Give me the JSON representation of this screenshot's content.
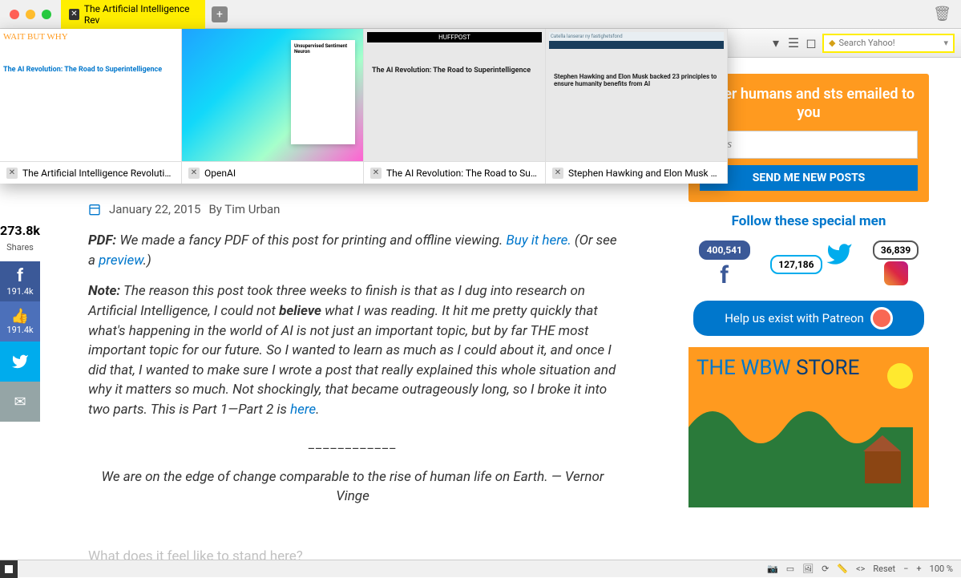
{
  "window": {
    "tab_title": "The Artificial Intelligence Rev"
  },
  "toolbar": {
    "search_placeholder": "Search Yahoo!"
  },
  "tab_switcher": {
    "thumbs": [
      {
        "label": "The Artificial Intelligence Revolution:",
        "headline": "The AI Revolution: The Road to Superintelligence",
        "logo": "WAIT BUT WHY"
      },
      {
        "label": "OpenAI",
        "card_title": "Unsupervised Sentiment Neuron"
      },
      {
        "label": "The AI Revolution: The Road to Supe...",
        "banner": "HUFFPOST",
        "headline": "The AI Revolution: The Road to Superintelligence"
      },
      {
        "label": "Stephen Hawking and Elon Musk ba...",
        "header": "Catella lanserar ny fastighetsfond",
        "headline": "Stephen Hawking and Elon Musk backed 23 principles to ensure humanity benefits from AI"
      }
    ]
  },
  "share": {
    "total": "273.8k",
    "total_label": "Shares",
    "fb": "191.4k",
    "like": "191.4k"
  },
  "article": {
    "date": "January 22, 2015",
    "byline": "By Tim Urban",
    "pdf_label": "PDF:",
    "pdf_text": " We made a fancy PDF of this post for printing and offline viewing. ",
    "buy_link": "Buy it here.",
    "or_see": " (Or see a ",
    "preview": "preview",
    "dot": ".)",
    "note_label": "Note:",
    "note_body": " The reason this post took three weeks to finish is that as I dug into research on Artificial Intelligence, I could not ",
    "believe": "believe",
    "note_body2": " what I was reading. It hit me pretty quickly that what's happening in the world of AI is not just an important topic, but by far THE most important topic for our future. So I wanted to learn as much as I could about it, and once I did that, I wanted to make sure I wrote a post that really explained this whole situation and why it matters so much. Not shockingly, that became outrageously long, so I broke it into two parts. This is Part 1—Part 2 is ",
    "here": "here",
    "quote": "We are on the edge of change comparable to the rise of human life on Earth. — Vernor Vinge",
    "teaser": "What does it feel like to stand here?"
  },
  "sidebar": {
    "join_h": "other humans and sts emailed to you",
    "email_placeholder": "dress",
    "send_btn": "SEND ME NEW POSTS",
    "follow": "Follow these special men",
    "counts": {
      "fb": "400,541",
      "tw": "127,186",
      "ig": "36,839"
    },
    "patreon": "Help us exist with Patreon",
    "store1": "THE WBW ",
    "store2": "STORE"
  },
  "statusbar": {
    "reset": "Reset",
    "zoom": "100 %"
  }
}
